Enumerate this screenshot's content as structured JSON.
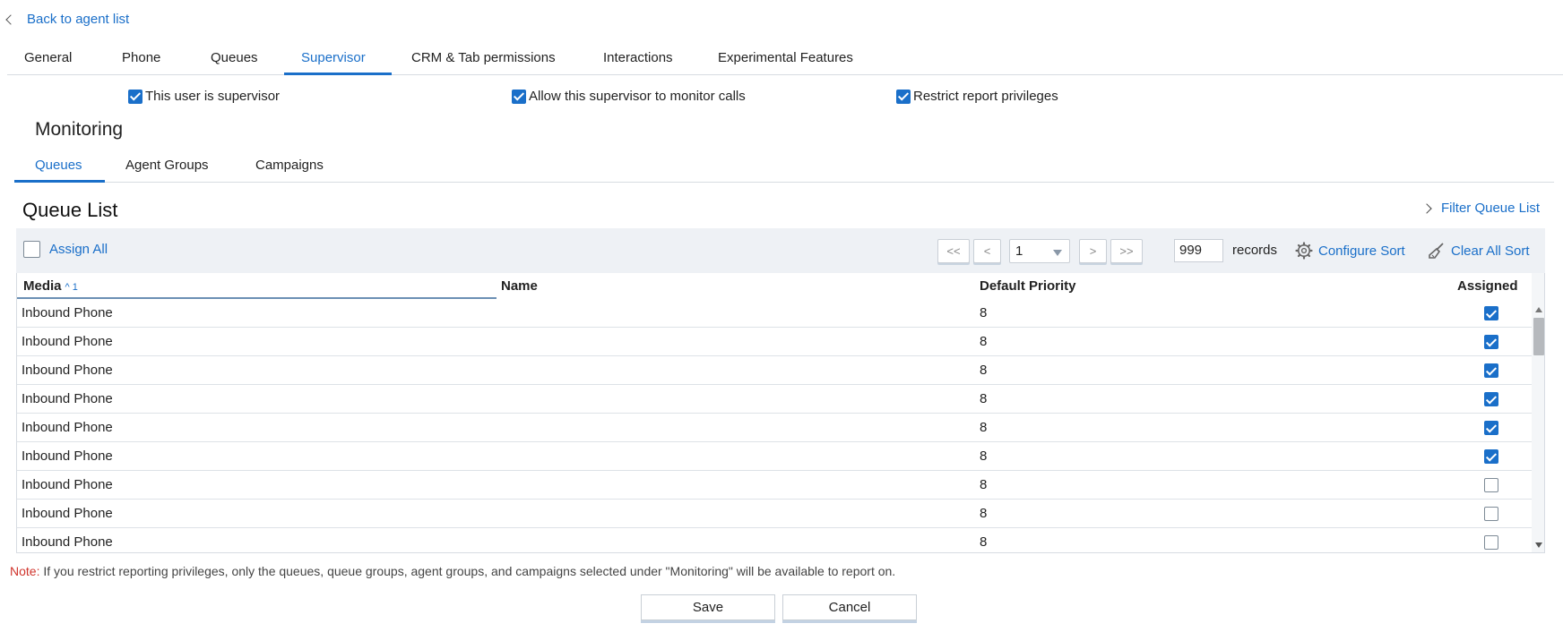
{
  "nav": {
    "back_label": "Back to agent list"
  },
  "main_tabs": [
    {
      "label": "General",
      "active": false
    },
    {
      "label": "Phone",
      "active": false
    },
    {
      "label": "Queues",
      "active": false
    },
    {
      "label": "Supervisor",
      "active": true
    },
    {
      "label": "CRM & Tab permissions",
      "active": false
    },
    {
      "label": "Interactions",
      "active": false
    },
    {
      "label": "Experimental Features",
      "active": false
    }
  ],
  "options": [
    {
      "label": "This user is supervisor",
      "checked": true
    },
    {
      "label": "Allow this supervisor to monitor calls",
      "checked": true
    },
    {
      "label": "Restrict report privileges",
      "checked": true
    }
  ],
  "monitoring": {
    "title": "Monitoring",
    "tabs": [
      {
        "label": "Queues",
        "active": true
      },
      {
        "label": "Agent Groups",
        "active": false
      },
      {
        "label": "Campaigns",
        "active": false
      }
    ]
  },
  "queue_list": {
    "title": "Queue List",
    "filter_label": "Filter Queue List",
    "assign_all_label": "Assign All",
    "pager": {
      "first": "<<",
      "prev": "<",
      "page": "1",
      "next": ">",
      "last": ">>"
    },
    "records_value": "999",
    "records_label": "records",
    "configure_sort_label": "Configure Sort",
    "clear_sort_label": "Clear All Sort",
    "columns": {
      "media": "Media",
      "media_sort": "^ 1",
      "name": "Name",
      "priority": "Default Priority",
      "assigned": "Assigned"
    },
    "rows": [
      {
        "media": "Inbound Phone",
        "name": "",
        "priority": "8",
        "assigned": true
      },
      {
        "media": "Inbound Phone",
        "name": "",
        "priority": "8",
        "assigned": true
      },
      {
        "media": "Inbound Phone",
        "name": "",
        "priority": "8",
        "assigned": true
      },
      {
        "media": "Inbound Phone",
        "name": "",
        "priority": "8",
        "assigned": true
      },
      {
        "media": "Inbound Phone",
        "name": "",
        "priority": "8",
        "assigned": true
      },
      {
        "media": "Inbound Phone",
        "name": "",
        "priority": "8",
        "assigned": true
      },
      {
        "media": "Inbound Phone",
        "name": "",
        "priority": "8",
        "assigned": false
      },
      {
        "media": "Inbound Phone",
        "name": "",
        "priority": "8",
        "assigned": false
      },
      {
        "media": "Inbound Phone",
        "name": "",
        "priority": "8",
        "assigned": false
      }
    ]
  },
  "note": {
    "label": "Note:",
    "text": " If you restrict reporting privileges, only the queues, queue groups, agent groups, and campaigns selected under \"Monitoring\" will be available to report on."
  },
  "actions": {
    "save_label": "Save",
    "cancel_label": "Cancel"
  },
  "colors": {
    "accent": "#1a6fc9",
    "note_label": "#d0342c",
    "toolbar_bg": "#eef1f5"
  }
}
